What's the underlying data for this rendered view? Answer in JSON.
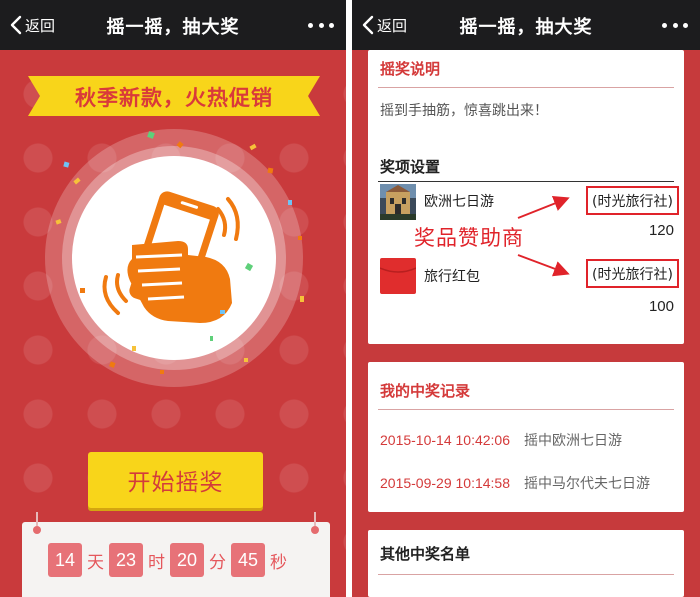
{
  "left": {
    "nav": {
      "back": "返回",
      "title": "摇一摇，抽大奖"
    },
    "banner": "秋季新款，火热促销",
    "start_button": "开始摇奖",
    "countdown": [
      {
        "value": "14",
        "unit": "天"
      },
      {
        "value": "23",
        "unit": "时"
      },
      {
        "value": "20",
        "unit": "分"
      },
      {
        "value": "45",
        "unit": "秒"
      }
    ],
    "icon": "phone-shake-icon"
  },
  "right": {
    "nav": {
      "back": "返回",
      "title": "摇一摇，抽大奖"
    },
    "rules": {
      "title": "摇奖说明",
      "text": "摇到手抽筋，惊喜跳出来！"
    },
    "prize_settings": {
      "title": "奖项设置",
      "items": [
        {
          "name": "欧洲七日游",
          "sponsor": "(时光旅行社)",
          "count": "120",
          "thumb": "travel-photo"
        },
        {
          "name": "旅行红包",
          "sponsor": "(时光旅行社)",
          "count": "100",
          "thumb": "red-envelope"
        }
      ]
    },
    "annotation": "奖品赞助商",
    "my_records": {
      "title": "我的中奖记录",
      "items": [
        {
          "datetime": "2015-10-14 10:42:06",
          "prize": "摇中欧洲七日游"
        },
        {
          "datetime": "2015-09-29 10:14:58",
          "prize": "摇中马尔代夫七日游"
        }
      ]
    },
    "other_winners": {
      "title": "其他中奖名单"
    }
  },
  "colors": {
    "background_red": "#c93a3c",
    "accent_red": "#d43a3a",
    "yellow": "#f8d51a",
    "navbar": "#1c1c1e",
    "orange_icon": "#f07a10",
    "annotation_red": "#e0232a"
  }
}
